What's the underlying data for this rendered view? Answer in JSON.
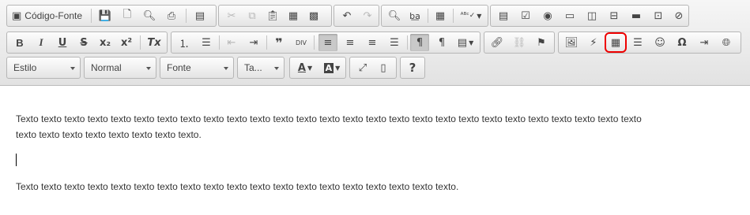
{
  "toolbar": {
    "source_label": "Código-Fonte",
    "icons_row1": {
      "source": "document-source-icon",
      "save": "save-icon",
      "new_page": "new-page-icon",
      "preview": "preview-icon",
      "print": "print-icon",
      "templates": "templates-icon",
      "cut": "cut-icon",
      "copy": "copy-icon",
      "paste": "paste-icon",
      "paste_text": "paste-text-icon",
      "paste_word": "paste-word-icon",
      "undo": "undo-icon",
      "redo": "redo-icon",
      "find": "find-icon",
      "replace": "replace-icon",
      "select_all": "select-all-icon",
      "spellcheck": "spellcheck-icon",
      "form": "form-icon",
      "checkbox": "checkbox-icon",
      "radio": "radio-icon",
      "textfield": "textfield-icon",
      "textarea": "textarea-icon",
      "select": "select-field-icon",
      "button": "button-icon",
      "imagebutton": "image-button-icon",
      "hiddenfield": "hidden-field-icon"
    },
    "row2": {
      "bold": "B",
      "italic": "I",
      "underline": "U",
      "strike": "S",
      "subscript": "x₂",
      "superscript": "x²",
      "remove_format": "Tx"
    },
    "styles": {
      "style_label": "Estilo",
      "format_label": "Normal",
      "font_label": "Fonte",
      "size_label": "Ta..."
    },
    "help_label": "?"
  },
  "editor": {
    "paragraph1": "Texto texto texto texto texto texto texto texto texto texto texto texto texto texto texto texto texto texto texto texto texto texto texto texto texto texto texto texto texto texto texto texto texto texto texto.",
    "paragraph2": "Texto texto texto texto texto texto texto texto texto texto texto texto texto texto texto texto texto texto texto."
  },
  "highlight": {
    "table_button_border": "#e00000"
  }
}
